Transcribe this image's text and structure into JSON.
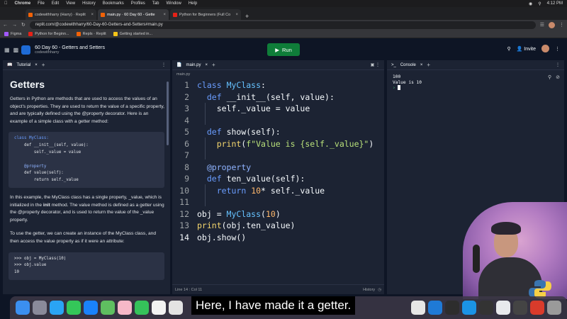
{
  "menubar": {
    "app": "Chrome",
    "items": [
      "File",
      "Edit",
      "View",
      "History",
      "Bookmarks",
      "Profiles",
      "Tab",
      "Window",
      "Help"
    ],
    "clock": "4:12 PM"
  },
  "tabs": [
    {
      "label": "codewithharry (Harry) · Replit",
      "active": false
    },
    {
      "label": "main.py · 60 Day 60 - Gette",
      "active": true
    },
    {
      "label": "Python for Beginners (Full Co",
      "active": false
    }
  ],
  "address": {
    "url": "replit.com/@codewithharry/60-Day-60-Getters-and-Setters#main.py"
  },
  "bookmarks": [
    "Figma",
    "Python for Beginn...",
    "Repls · Replit",
    "Getting started in..."
  ],
  "header": {
    "repl_name": "60 Day 60 - Getters and Setters",
    "user": "codewithharry",
    "run_label": "Run",
    "invite_label": "Invite"
  },
  "tutorial": {
    "tab_label": "Tutorial",
    "title": "Getters",
    "p1": "Getters in Python are methods that are used to access the values of an object's properties. They are used to return the value of a specific property, and are typically defined using the @property decorator. Here is an example of a simple class with a getter method:",
    "code1": [
      "class MyClass:",
      "    def __init__(self, value):",
      "        self._value = value",
      "",
      "    @property",
      "    def value(self):",
      "        return self._value"
    ],
    "p2_pre": "In this example, the MyClass class has a single property, _value, which is initialized in the ",
    "p2_bold": "init",
    "p2_post": " method. The value method is defined as a getter using the @property decorator, and is used to return the value of the _value property.",
    "p3": "To use the getter, we can create an instance of the MyClass class, and then access the value property as if it were an attribute:",
    "code2": [
      ">>> obj = MyClass(10)",
      ">>> obj.value",
      "10"
    ]
  },
  "editor": {
    "tab_label": "main.py",
    "file_label": "main.py",
    "lines": [
      {
        "n": "1",
        "text": "class MyClass:"
      },
      {
        "n": "2",
        "text": "  def __init__(self, value):"
      },
      {
        "n": "3",
        "text": "    self._value = value"
      },
      {
        "n": "4",
        "text": ""
      },
      {
        "n": "5",
        "text": "  def show(self):"
      },
      {
        "n": "6",
        "text": "    print(f\"Value is {self._value}\")"
      },
      {
        "n": "7",
        "text": ""
      },
      {
        "n": "8",
        "text": "  @property"
      },
      {
        "n": "9",
        "text": "  def ten_value(self):"
      },
      {
        "n": "10",
        "text": "    return 10* self._value"
      },
      {
        "n": "11",
        "text": ""
      },
      {
        "n": "12",
        "text": "obj = MyClass(10)"
      },
      {
        "n": "13",
        "text": "print(obj.ten_value)"
      },
      {
        "n": "14",
        "text": "obj.show()"
      }
    ],
    "status": "Line 14 : Col 11",
    "history_label": "History"
  },
  "console": {
    "tab_label": "Console",
    "output": [
      "100",
      "Value is 10"
    ]
  },
  "caption": "Here, I have made it a getter.",
  "colors": {
    "bg": "#0e1525",
    "panel": "#1c2333",
    "run": "#0f7d39",
    "keyword": "#6a9dff"
  }
}
